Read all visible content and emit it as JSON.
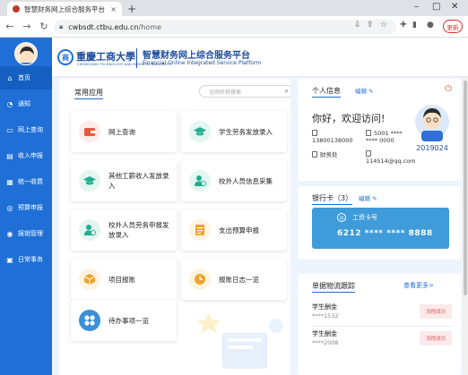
{
  "browser": {
    "tab_title": "智慧财务网上综合服务平台",
    "tab_close": "×",
    "new_tab": "+",
    "url_host": "cwbsdt.ctbu.edu.cn",
    "url_path": "/home",
    "update_label": "更新"
  },
  "header": {
    "university": "重慶工商大學",
    "university_en": "CHONGQING TECHNOLOGY AND BUSINESS UNIVERSITY",
    "logo_mark": "商",
    "system_title": "智慧财务网上综合服务平台",
    "system_subtitle": "Financial Online Integrated Service Platform"
  },
  "sidebar": {
    "items": [
      {
        "label": "首页",
        "icon": "home-icon"
      },
      {
        "label": "通知",
        "icon": "bell-icon"
      },
      {
        "label": "网上查询",
        "icon": "monitor-icon"
      },
      {
        "label": "收入申报",
        "icon": "income-icon"
      },
      {
        "label": "统一收费",
        "icon": "fee-icon"
      },
      {
        "label": "预算申报",
        "icon": "budget-icon"
      },
      {
        "label": "报销管理",
        "icon": "reimburse-icon"
      },
      {
        "label": "日常事务",
        "icon": "affairs-icon"
      }
    ]
  },
  "apps": {
    "title": "常用应用",
    "search_placeholder": "全网名称搜索",
    "items": [
      {
        "label": "网上查询",
        "icon": "wallet-icon",
        "color": "#e8583f",
        "bg": "#fdecea"
      },
      {
        "label": "学生劳务发放录入",
        "icon": "graduation-cap-icon",
        "color": "#1fae8f",
        "bg": "#e3f6f1"
      },
      {
        "label": "其他工薪收入发放录入",
        "icon": "graduation-cap-icon",
        "color": "#1fae8f",
        "bg": "#e3f6f1"
      },
      {
        "label": "校外人员信息采集",
        "icon": "user-info-icon",
        "color": "#1fae8f",
        "bg": "#e3f6f1"
      },
      {
        "label": "校外人员劳务申报发放录入",
        "icon": "user-pay-icon",
        "color": "#1fae8f",
        "bg": "#e3f6f1"
      },
      {
        "label": "支出预算申报",
        "icon": "document-list-icon",
        "color": "#f0a32a",
        "bg": "#fdf3e1"
      },
      {
        "label": "项目报账",
        "icon": "box-icon",
        "color": "#f0a32a",
        "bg": "#fdf3e1"
      },
      {
        "label": "报账日志一览",
        "icon": "clock-icon",
        "color": "#f0a32a",
        "bg": "#fdf3e1"
      },
      {
        "label": "待办事项一览",
        "icon": "grid-icon",
        "color": "#3b8fd9",
        "bg": "#e3f0fc"
      }
    ]
  },
  "personal": {
    "title": "个人信息",
    "edit": "编辑",
    "greeting": "你好，欢迎访问!",
    "phone": "13800138000",
    "id_card": "5001 **** **** 0000",
    "office": "财务处",
    "email": "114514@qq.com",
    "student_id": "2019024"
  },
  "bank": {
    "title": "银行卡",
    "count": "（3）",
    "edit": "编辑",
    "bank_name": "工资卡号",
    "card_number": "6212 **** **** 8888"
  },
  "tracking": {
    "title": "单据物流跟踪",
    "more": "查看更多>",
    "items": [
      {
        "name": "学生酬金",
        "number": "****1532",
        "status": "流程成功"
      },
      {
        "name": "学生酬金",
        "number": "****2008",
        "status": "流程成功"
      }
    ]
  }
}
